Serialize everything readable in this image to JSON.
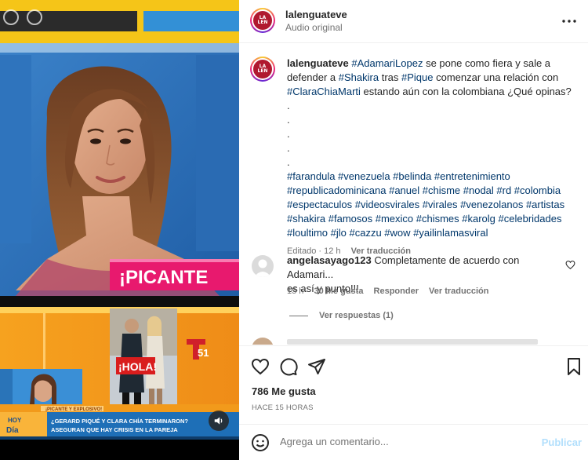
{
  "post": {
    "username": "lalenguateve",
    "audio": "Audio original",
    "more_icon": "more-horizontal-icon"
  },
  "caption": {
    "username": "lalenguateve",
    "lead_tag": "#AdamariLopez",
    "text1": " se pone como fiera y sale a defender a ",
    "tag2": "#Shakira",
    "text2": " tras ",
    "tag3": "#Pique",
    "text3": " comenzar una relación con ",
    "tag4": "#ClaraChiaMarti",
    "text4": " estando aún con la colombiana ¿Qué opinas?",
    "dots": [
      ".",
      ".",
      ".",
      ".",
      "."
    ],
    "hashtag_lines": [
      "#farandula #venezuela #belinda #entretenimiento",
      "#republicadominicana #anuel #chisme #nodal #rd #colombia",
      "#espectaculos #videosvirales #virales #venezolanos #artistas",
      "#shakira #famosos #mexico #chismes #karolg #celebridades",
      "#loultimo #jlo #cazzu #wow #yailinlamasviral"
    ],
    "edited": "Editado · 12 h",
    "see_translation": "Ver traducción"
  },
  "comment": {
    "username": "angelasayago123",
    "text_line1": "Completamente de acuerdo con Adamari...",
    "text_line2": "es así y punto!!!",
    "time": "15 h",
    "likes": "30 Me gusta",
    "reply": "Responder",
    "see_translation": "Ver traducción",
    "view_replies": "Ver respuestas (1)"
  },
  "stats": {
    "likes": "786 Me gusta",
    "time_ago": "HACE 15 HORAS"
  },
  "add_comment": {
    "placeholder": "Agrega un comentario...",
    "publish": "Publicar"
  },
  "video": {
    "banner_text": "¡PICANTE",
    "hola_text": "¡HOLA!",
    "channel": "51",
    "lower_label": "¡PICANTE Y EXPLOSIVO!",
    "show_name_1": "HOY",
    "show_name_2": "Día",
    "ticker_line1": "¿GERARD PIQUÉ Y CLARA CHÍA TERMINARON?",
    "ticker_line2": "ASEGURAN QUE HAY CRISIS EN LA PAREJA"
  },
  "colors": {
    "accent_link": "#00376b",
    "publish_disabled": "#b2dffc",
    "banner_pink": "#e8196e",
    "tv_orange": "#f29a1b",
    "tv_blue": "#1e6fb7"
  }
}
